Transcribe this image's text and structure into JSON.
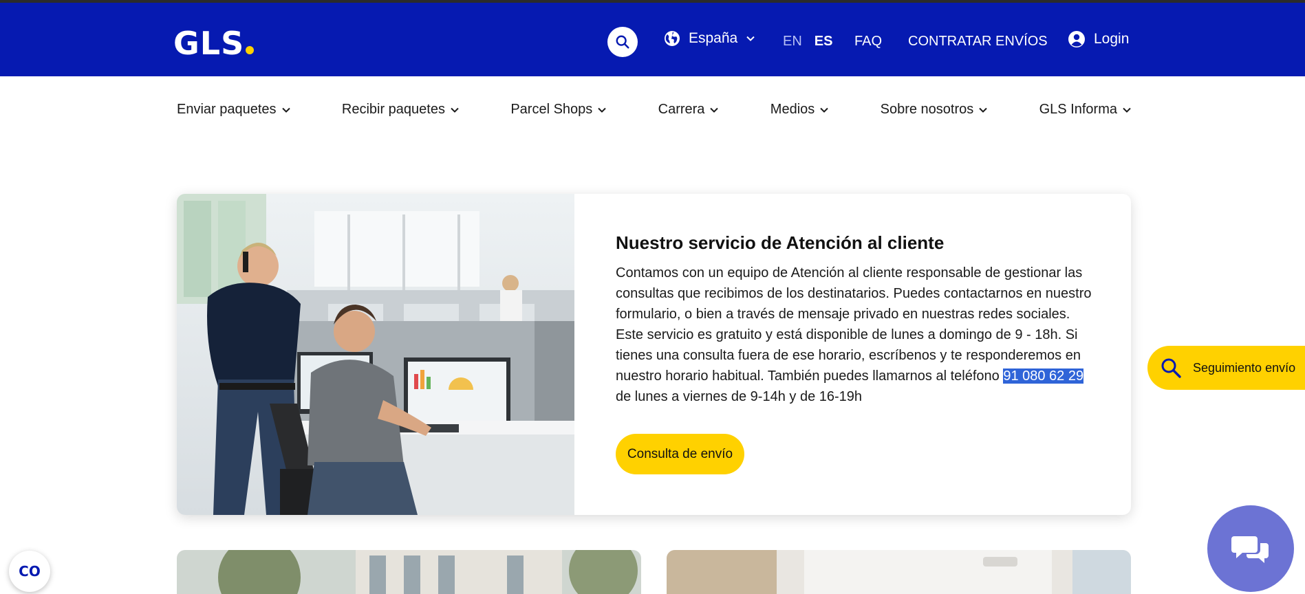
{
  "header": {
    "logo_text": "GLS",
    "country": "España",
    "lang_en": "EN",
    "lang_es": "ES",
    "faq": "FAQ",
    "contratar": "CONTRATAR ENVÍOS",
    "login": "Login"
  },
  "nav": {
    "items": [
      {
        "label": "Enviar paquetes"
      },
      {
        "label": "Recibir paquetes"
      },
      {
        "label": "Parcel Shops"
      },
      {
        "label": "Carrera"
      },
      {
        "label": "Medios"
      },
      {
        "label": "Sobre nosotros"
      },
      {
        "label": "GLS Informa"
      }
    ]
  },
  "hero": {
    "title": "Nuestro servicio de Atención al cliente",
    "text_before": "Contamos con un equipo de Atención al cliente responsable de gestionar las consultas que recibimos de los destinatarios. Puedes contactarnos en nuestro formulario, o bien a través de mensaje privado en nuestras redes sociales. Este servicio es gratuito y está disponible de lunes a domingo de 9 - 18h. Si tienes una consulta fuera de ese horario, escríbenos y te responderemos en nuestro horario habitual. También puedes llamarnos al teléfono ",
    "phone": "91 080 62 29",
    "text_after": " de lunes a viernes de 9-14h y de 16-19h",
    "cta": "Consulta de envío"
  },
  "widgets": {
    "tracking": "Seguimiento envío",
    "cookie": "CO"
  },
  "colors": {
    "brand_blue": "#061ab1",
    "brand_yellow": "#ffd100",
    "chat_purple": "#6c73d4"
  }
}
